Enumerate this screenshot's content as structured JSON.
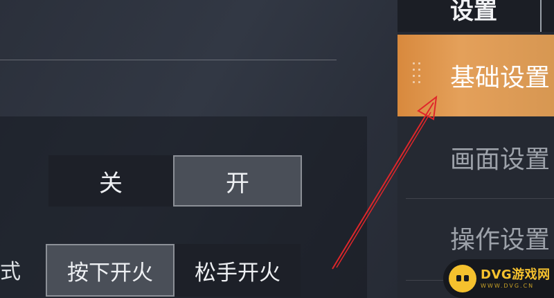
{
  "sidebar": {
    "header_title": "设置",
    "tabs": [
      {
        "label": "基础设置",
        "active": true
      },
      {
        "label": "画面设置",
        "active": false
      },
      {
        "label": "操作设置",
        "active": false
      }
    ]
  },
  "settings": {
    "toggle_row": {
      "options": [
        "关",
        "开"
      ],
      "selected": "开"
    },
    "fire_mode_row": {
      "label": "式",
      "options": [
        "按下开火",
        "松手开火"
      ],
      "selected": "按下开火"
    }
  },
  "watermark": {
    "name": "DVG游戏网",
    "url": "WWW.DVG.CN"
  },
  "colors": {
    "accent": "#e09a50",
    "annotation_arrow": "#e0262a",
    "logo": "#f5c12e"
  }
}
